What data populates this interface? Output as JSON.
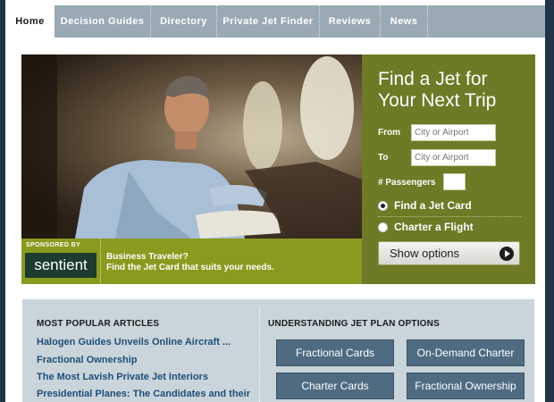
{
  "nav": {
    "tabs": [
      {
        "label": "Home",
        "active": true
      },
      {
        "label": "Decision Guides"
      },
      {
        "label": "Directory"
      },
      {
        "label": "Private Jet Finder"
      },
      {
        "label": "Reviews"
      },
      {
        "label": "News"
      }
    ]
  },
  "sponsor": {
    "sponsored_by": "SPONSORED BY",
    "brand": "sentient",
    "line1": "Business Traveler?",
    "line2": "Find the Jet Card that suits your needs."
  },
  "finder": {
    "title_line1": "Find a Jet for",
    "title_line2": "Your Next Trip",
    "from_label": "From",
    "from_placeholder": "City or Airport",
    "to_label": "To",
    "to_placeholder": "City or Airport",
    "passengers_label": "# Passengers",
    "passengers_value": "",
    "option_jet_card": "Find a Jet Card",
    "option_charter": "Charter a Flight",
    "selected_option": "Find a Jet Card",
    "show_options": "Show options"
  },
  "articles": {
    "title": "MOST POPULAR ARTICLES",
    "items": [
      "Halogen Guides Unveils Online Aircraft ...",
      "Fractional Ownership",
      "The Most Lavish Private Jet Interiors",
      "Presidential Planes: The Candidates and their"
    ]
  },
  "plans": {
    "title": "UNDERSTANDING JET PLAN OPTIONS",
    "buttons": [
      "Fractional Cards",
      "On-Demand Charter",
      "Charter Cards",
      "Fractional Ownership"
    ]
  },
  "colors": {
    "nav_bg": "#9aaab4",
    "finder_bg": "#6e7a26",
    "sponsor_bg": "#8a9a1e",
    "plan_button": "#4f6b82",
    "link": "#1f4e79"
  }
}
